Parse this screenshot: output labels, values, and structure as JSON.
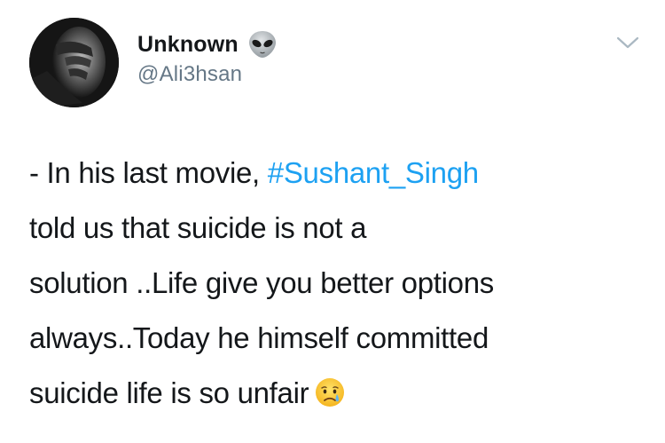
{
  "user": {
    "display_name": "Unknown",
    "handle": "@Ali3hsan",
    "badge_icon": "alien-emoji-icon"
  },
  "menu": {
    "icon": "chevron-down-icon"
  },
  "tweet": {
    "line1_prefix": "- In his last movie, ",
    "hashtag": "#Sushant_Singh",
    "line2": "told us that suicide is not a",
    "line3": "solution ..Life give you better options",
    "line4": "always..Today he himself committed",
    "line5": "suicide life is so unfair",
    "end_icon": "crying-face-icon"
  },
  "colors": {
    "text": "#14171a",
    "secondary": "#657786",
    "hashtag": "#1da1f2",
    "chevron": "#aab8c2"
  }
}
